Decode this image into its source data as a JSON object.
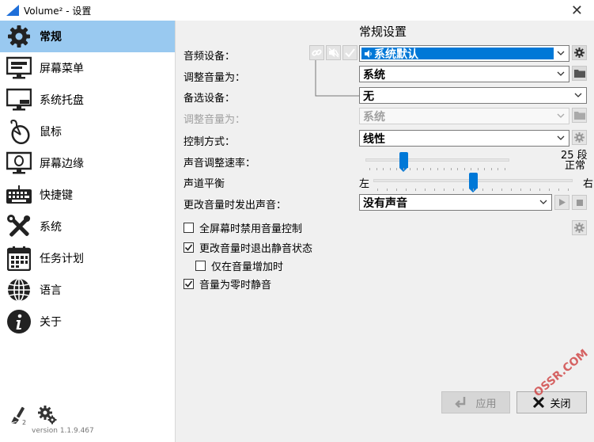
{
  "window": {
    "title": "Volume² - 设置"
  },
  "sidebar": {
    "items": [
      {
        "label": "常规",
        "icon": "gear-icon",
        "active": true
      },
      {
        "label": "屏幕菜单",
        "icon": "monitor-icon"
      },
      {
        "label": "系统托盘",
        "icon": "tray-icon"
      },
      {
        "label": "鼠标",
        "icon": "mouse-icon"
      },
      {
        "label": "屏幕边缘",
        "icon": "screen-edge-icon"
      },
      {
        "label": "快捷键",
        "icon": "keyboard-icon"
      },
      {
        "label": "系统",
        "icon": "tools-icon"
      },
      {
        "label": "任务计划",
        "icon": "calendar-icon"
      },
      {
        "label": "语言",
        "icon": "globe-icon"
      },
      {
        "label": "关于",
        "icon": "info-icon"
      }
    ],
    "version": "version 1.1.9.467",
    "version_digit": "2"
  },
  "main": {
    "heading": "常规设置",
    "audio_device": {
      "label": "音频设备：",
      "value": "系统默认"
    },
    "adjust_volume_1": {
      "label": "调整音量为：",
      "value": "系统"
    },
    "alt_device": {
      "label": "备选设备：",
      "value": "无"
    },
    "adjust_volume_2": {
      "label": "调整音量为：",
      "value": "系统"
    },
    "control_mode": {
      "label": "控制方式：",
      "value": "线性"
    },
    "rate": {
      "label": "声音调整速率：",
      "value_text": "25 段",
      "mode_text": "正常",
      "position": 0.25
    },
    "balance": {
      "label": "声道平衡",
      "left": "左",
      "right": "右",
      "position": 0.5
    },
    "change_sound": {
      "label": "更改音量时发出声音：",
      "value": "没有声音"
    },
    "checkboxes": [
      {
        "label": "全屏幕时禁用音量控制",
        "checked": false
      },
      {
        "label": "更改音量时退出静音状态",
        "checked": true
      },
      {
        "label": "仅在音量增加时",
        "checked": false
      },
      {
        "label": "音量为零时静音",
        "checked": true
      }
    ]
  },
  "buttons": {
    "apply": "应用",
    "close": "关闭"
  },
  "watermark": "OSSR.COM"
}
